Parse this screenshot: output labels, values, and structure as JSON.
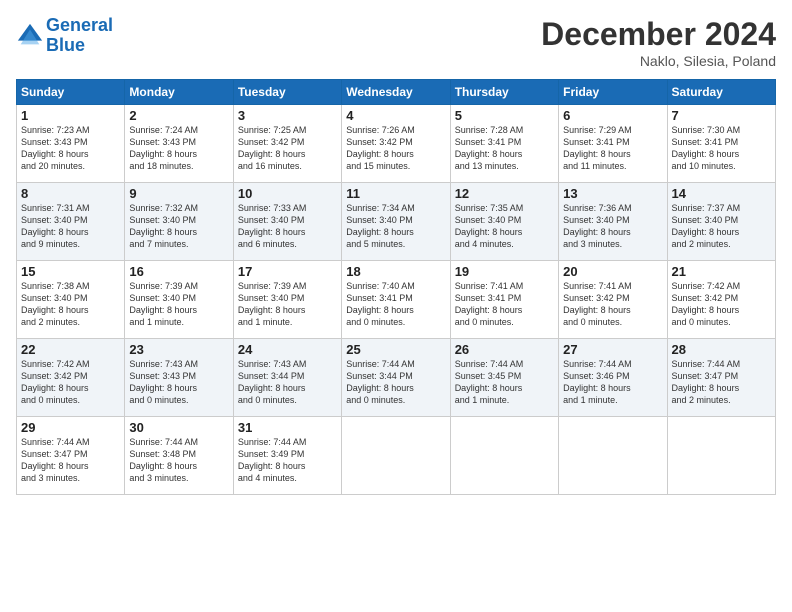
{
  "header": {
    "logo_line1": "General",
    "logo_line2": "Blue",
    "month_title": "December 2024",
    "location": "Naklo, Silesia, Poland"
  },
  "days_of_week": [
    "Sunday",
    "Monday",
    "Tuesday",
    "Wednesday",
    "Thursday",
    "Friday",
    "Saturday"
  ],
  "weeks": [
    [
      {
        "day": "1",
        "info": "Sunrise: 7:23 AM\nSunset: 3:43 PM\nDaylight: 8 hours\nand 20 minutes."
      },
      {
        "day": "2",
        "info": "Sunrise: 7:24 AM\nSunset: 3:43 PM\nDaylight: 8 hours\nand 18 minutes."
      },
      {
        "day": "3",
        "info": "Sunrise: 7:25 AM\nSunset: 3:42 PM\nDaylight: 8 hours\nand 16 minutes."
      },
      {
        "day": "4",
        "info": "Sunrise: 7:26 AM\nSunset: 3:42 PM\nDaylight: 8 hours\nand 15 minutes."
      },
      {
        "day": "5",
        "info": "Sunrise: 7:28 AM\nSunset: 3:41 PM\nDaylight: 8 hours\nand 13 minutes."
      },
      {
        "day": "6",
        "info": "Sunrise: 7:29 AM\nSunset: 3:41 PM\nDaylight: 8 hours\nand 11 minutes."
      },
      {
        "day": "7",
        "info": "Sunrise: 7:30 AM\nSunset: 3:41 PM\nDaylight: 8 hours\nand 10 minutes."
      }
    ],
    [
      {
        "day": "8",
        "info": "Sunrise: 7:31 AM\nSunset: 3:40 PM\nDaylight: 8 hours\nand 9 minutes."
      },
      {
        "day": "9",
        "info": "Sunrise: 7:32 AM\nSunset: 3:40 PM\nDaylight: 8 hours\nand 7 minutes."
      },
      {
        "day": "10",
        "info": "Sunrise: 7:33 AM\nSunset: 3:40 PM\nDaylight: 8 hours\nand 6 minutes."
      },
      {
        "day": "11",
        "info": "Sunrise: 7:34 AM\nSunset: 3:40 PM\nDaylight: 8 hours\nand 5 minutes."
      },
      {
        "day": "12",
        "info": "Sunrise: 7:35 AM\nSunset: 3:40 PM\nDaylight: 8 hours\nand 4 minutes."
      },
      {
        "day": "13",
        "info": "Sunrise: 7:36 AM\nSunset: 3:40 PM\nDaylight: 8 hours\nand 3 minutes."
      },
      {
        "day": "14",
        "info": "Sunrise: 7:37 AM\nSunset: 3:40 PM\nDaylight: 8 hours\nand 2 minutes."
      }
    ],
    [
      {
        "day": "15",
        "info": "Sunrise: 7:38 AM\nSunset: 3:40 PM\nDaylight: 8 hours\nand 2 minutes."
      },
      {
        "day": "16",
        "info": "Sunrise: 7:39 AM\nSunset: 3:40 PM\nDaylight: 8 hours\nand 1 minute."
      },
      {
        "day": "17",
        "info": "Sunrise: 7:39 AM\nSunset: 3:40 PM\nDaylight: 8 hours\nand 1 minute."
      },
      {
        "day": "18",
        "info": "Sunrise: 7:40 AM\nSunset: 3:41 PM\nDaylight: 8 hours\nand 0 minutes."
      },
      {
        "day": "19",
        "info": "Sunrise: 7:41 AM\nSunset: 3:41 PM\nDaylight: 8 hours\nand 0 minutes."
      },
      {
        "day": "20",
        "info": "Sunrise: 7:41 AM\nSunset: 3:42 PM\nDaylight: 8 hours\nand 0 minutes."
      },
      {
        "day": "21",
        "info": "Sunrise: 7:42 AM\nSunset: 3:42 PM\nDaylight: 8 hours\nand 0 minutes."
      }
    ],
    [
      {
        "day": "22",
        "info": "Sunrise: 7:42 AM\nSunset: 3:42 PM\nDaylight: 8 hours\nand 0 minutes."
      },
      {
        "day": "23",
        "info": "Sunrise: 7:43 AM\nSunset: 3:43 PM\nDaylight: 8 hours\nand 0 minutes."
      },
      {
        "day": "24",
        "info": "Sunrise: 7:43 AM\nSunset: 3:44 PM\nDaylight: 8 hours\nand 0 minutes."
      },
      {
        "day": "25",
        "info": "Sunrise: 7:44 AM\nSunset: 3:44 PM\nDaylight: 8 hours\nand 0 minutes."
      },
      {
        "day": "26",
        "info": "Sunrise: 7:44 AM\nSunset: 3:45 PM\nDaylight: 8 hours\nand 1 minute."
      },
      {
        "day": "27",
        "info": "Sunrise: 7:44 AM\nSunset: 3:46 PM\nDaylight: 8 hours\nand 1 minute."
      },
      {
        "day": "28",
        "info": "Sunrise: 7:44 AM\nSunset: 3:47 PM\nDaylight: 8 hours\nand 2 minutes."
      }
    ],
    [
      {
        "day": "29",
        "info": "Sunrise: 7:44 AM\nSunset: 3:47 PM\nDaylight: 8 hours\nand 3 minutes."
      },
      {
        "day": "30",
        "info": "Sunrise: 7:44 AM\nSunset: 3:48 PM\nDaylight: 8 hours\nand 3 minutes."
      },
      {
        "day": "31",
        "info": "Sunrise: 7:44 AM\nSunset: 3:49 PM\nDaylight: 8 hours\nand 4 minutes."
      },
      {
        "day": "",
        "info": ""
      },
      {
        "day": "",
        "info": ""
      },
      {
        "day": "",
        "info": ""
      },
      {
        "day": "",
        "info": ""
      }
    ]
  ]
}
